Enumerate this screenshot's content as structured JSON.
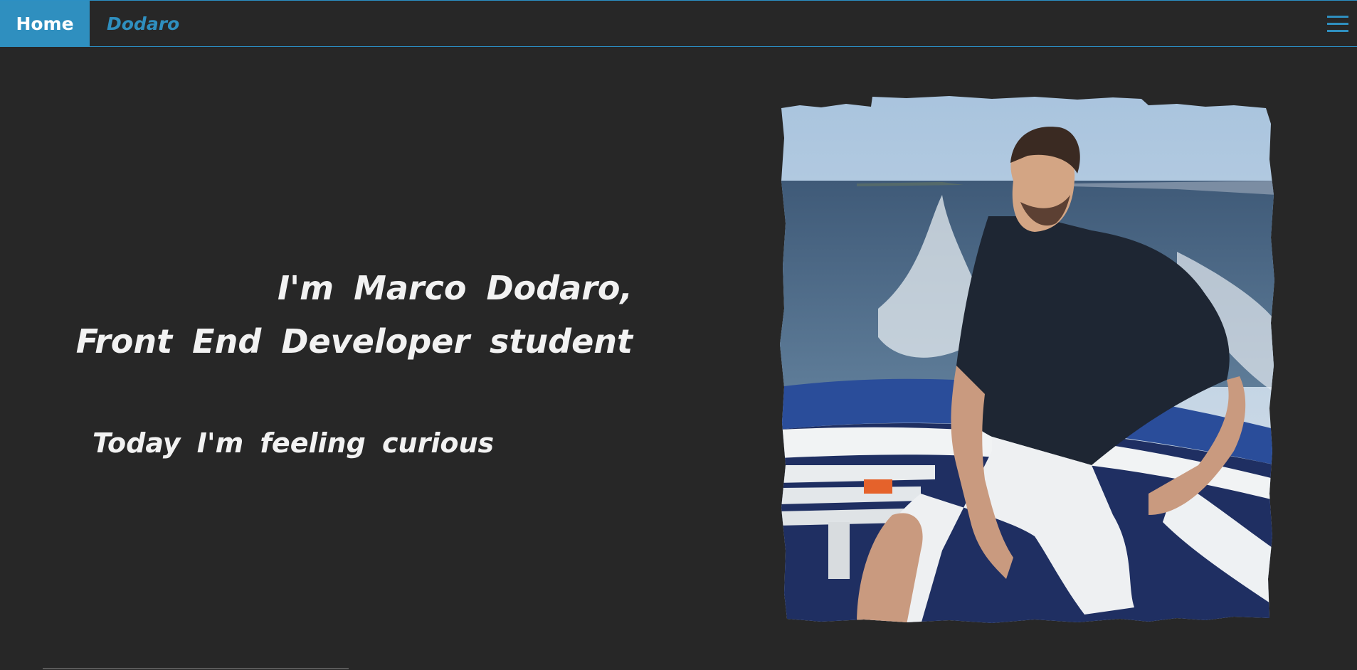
{
  "nav": {
    "home_label": "Home",
    "brand_label": "Dodaro",
    "menu_icon": "hamburger-icon",
    "accent_color": "#2f8fbf"
  },
  "hero": {
    "line1": "I'm Marco Dodaro,",
    "line2": "Front End Developer student",
    "mood": "Today I'm feeling curious"
  },
  "photo": {
    "subject": "profile-photo"
  },
  "colors": {
    "background": "#272727",
    "text": "#f2f2f2"
  }
}
